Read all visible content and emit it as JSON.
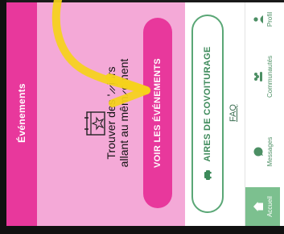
{
  "event_card": {
    "header": "Événements",
    "description_line1": "Trouver des ' ̷ ̷ jurs",
    "description_line2": "allant au mêm ̷ oment",
    "button_label": "VOIR LES ÉVÉNEMENTS",
    "colors": {
      "header": "#e8389c",
      "card": "#f4a9d7",
      "button": "#e8389c"
    }
  },
  "carpool": {
    "label": "AIRES DE COVOITURAGE",
    "icon": "car-icon",
    "color": "#5aa776"
  },
  "faq": {
    "label": "FAQ"
  },
  "bottom_nav": {
    "items": [
      {
        "label": "Accueil",
        "icon": "home-icon",
        "active": true
      },
      {
        "label": "Messages",
        "icon": "chat-icon",
        "active": false
      },
      {
        "label": "Communautés",
        "icon": "people-icon",
        "active": false
      },
      {
        "label": "Profil",
        "icon": "person-icon",
        "active": false
      }
    ],
    "active_color": "#7cc08f"
  },
  "annotation": {
    "color": "#f5d21a",
    "shape": "arrow"
  }
}
